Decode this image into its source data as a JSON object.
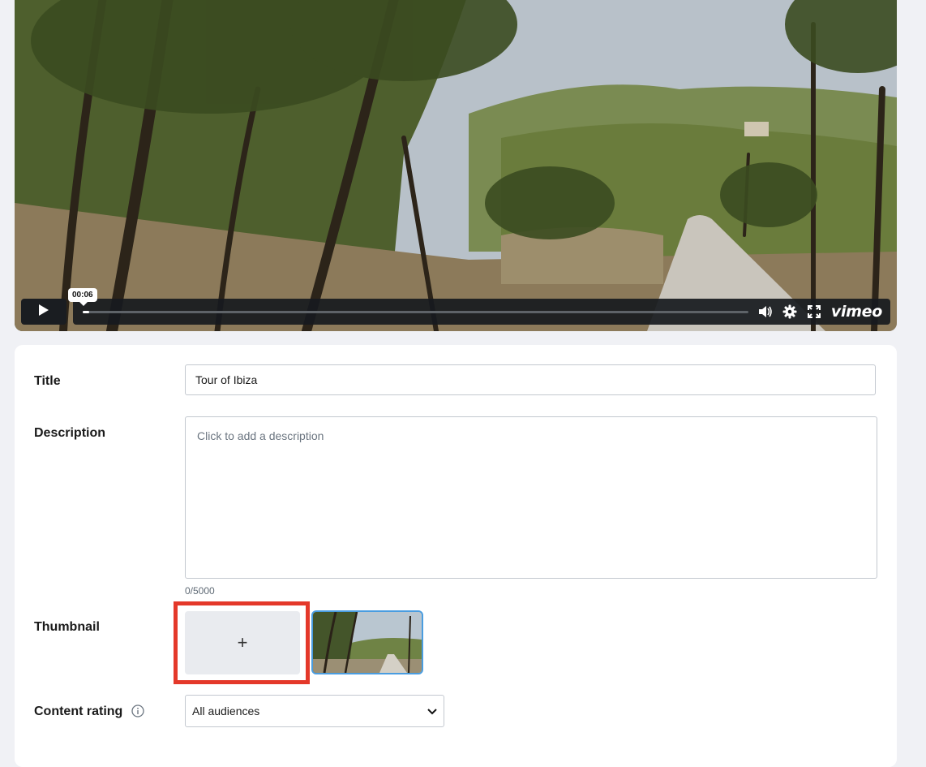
{
  "player": {
    "timestamp": "00:06",
    "progress": 0.01,
    "brand": "vimeo",
    "icons": [
      "play-icon",
      "volume-icon",
      "settings-gear-icon",
      "fullscreen-icon"
    ]
  },
  "form": {
    "title": {
      "label": "Title",
      "value": "Tour of Ibiza"
    },
    "description": {
      "label": "Description",
      "placeholder": "Click to add a description",
      "counter": "0/5000"
    },
    "thumbnail": {
      "label": "Thumbnail",
      "add_symbol": "+"
    },
    "content_rating": {
      "label": "Content rating",
      "value": "All audiences"
    }
  },
  "colors": {
    "highlight": "#e4382a",
    "selected_thumbnail_border": "#4a9de0",
    "page_background": "#f0f1f5"
  }
}
